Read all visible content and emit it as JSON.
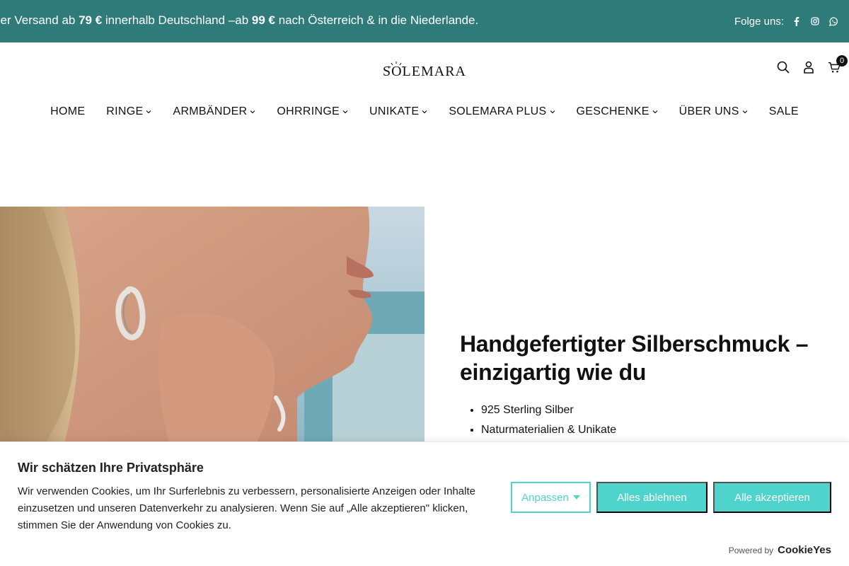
{
  "announcement": {
    "part1": "ser Versand ab ",
    "amount_de": "79 €",
    "part2": " innerhalb Deutschland –ab ",
    "amount_at_nl": "99 €",
    "part3": " nach Österreich & in die Niederlande.",
    "follow_label": "Folge uns:",
    "socials": [
      "facebook-icon",
      "instagram-icon",
      "whatsapp-icon"
    ]
  },
  "header": {
    "logo_text": "SOLEMARA",
    "cart_count": "0"
  },
  "nav": {
    "items": [
      {
        "label": "HOME",
        "has_dropdown": false
      },
      {
        "label": "RINGE",
        "has_dropdown": true
      },
      {
        "label": "ARMBÄNDER",
        "has_dropdown": true
      },
      {
        "label": "OHRRINGE",
        "has_dropdown": true
      },
      {
        "label": "UNIKATE",
        "has_dropdown": true
      },
      {
        "label": "SOLEMARA PLUS",
        "has_dropdown": true
      },
      {
        "label": "GESCHENKE",
        "has_dropdown": true
      },
      {
        "label": "ÜBER UNS",
        "has_dropdown": true
      },
      {
        "label": "SALE",
        "has_dropdown": false
      }
    ]
  },
  "hero": {
    "title": "Handgefertigter Silberschmuck – einzigartig wie du",
    "bullets": [
      "925 Sterling Silber",
      "Naturmaterialien & Unikate"
    ]
  },
  "cookie": {
    "title": "Wir schätzen Ihre Privatsphäre",
    "description": "Wir verwenden Cookies, um Ihr Surferlebnis zu verbessern, personalisierte Anzeigen oder Inhalte einzusetzen und unseren Datenverkehr zu analysieren. Wenn Sie auf „Alle akzeptieren\" klicken, stimmen Sie der Anwendung von Cookies zu.",
    "customize_label": "Anpassen",
    "reject_label": "Alles ablehnen",
    "accept_label": "Alle akzeptieren",
    "powered_by": "Powered by",
    "brand": "CookieYes"
  },
  "colors": {
    "announce_bg": "#2e7b7a",
    "cookie_accent": "#4ed4cd"
  }
}
